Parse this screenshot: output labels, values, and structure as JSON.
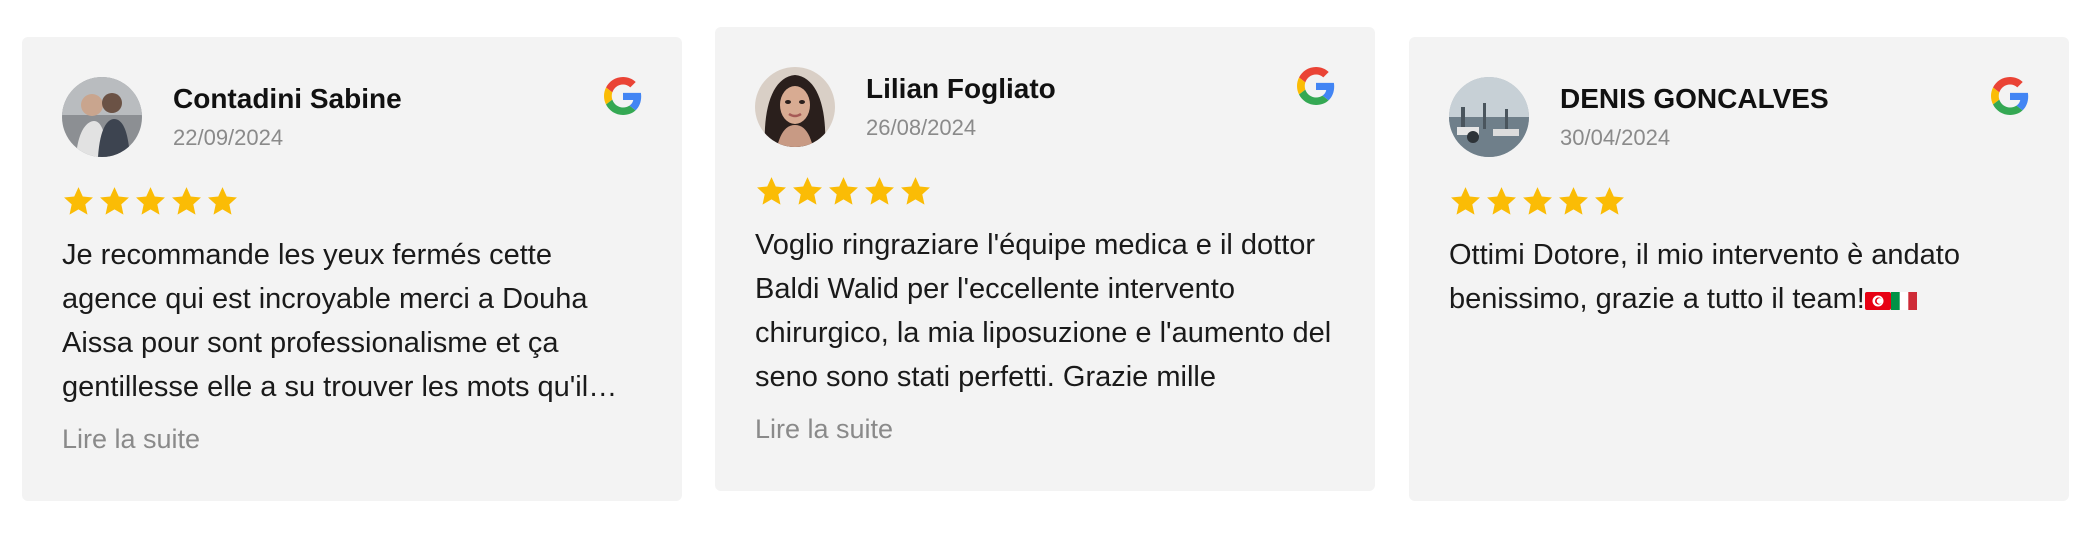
{
  "reviews": [
    {
      "author": "Contadini Sabine",
      "date": "22/09/2024",
      "rating": 5,
      "text": "Je recommande les yeux fermés cette agence qui est incroyable merci a Douha Aissa pour sont professionalisme et ça gentillesse elle a su trouver les mots qu'il fallait",
      "read_more": "Lire la suite",
      "avatar_icon": "user-photo",
      "source_icon": "google-icon"
    },
    {
      "author": "Lilian Fogliato",
      "date": "26/08/2024",
      "rating": 5,
      "text": "Voglio ringraziare l'équipe medica e il dottor Baldi Walid per l'eccellente intervento chirurgico, la mia liposuzione e l'aumento del seno sono stati perfetti. Grazie mille",
      "read_more": "Lire la suite",
      "avatar_icon": "user-photo",
      "source_icon": "google-icon"
    },
    {
      "author": "DENIS GONCALVES",
      "date": "30/04/2024",
      "rating": 5,
      "text": "Ottimi Dotore, il mio intervento è andato benissimo, grazie a tutto il team!",
      "flags": [
        "tunisia-flag",
        "italy-flag"
      ],
      "avatar_icon": "user-photo",
      "source_icon": "google-icon"
    }
  ],
  "colors": {
    "card_bg": "#f3f3f3",
    "star": "#fbbc05",
    "muted_text": "#8a8a8a"
  }
}
